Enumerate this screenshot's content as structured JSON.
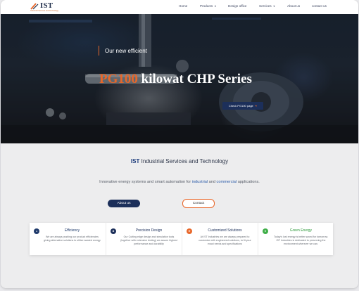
{
  "brand": {
    "logo_text": "IST",
    "tagline": "Industrial Services and Technology"
  },
  "nav": {
    "items": [
      {
        "label": "Home",
        "dropdown": false
      },
      {
        "label": "Products",
        "dropdown": true
      },
      {
        "label": "Design office",
        "dropdown": false
      },
      {
        "label": "Services",
        "dropdown": true
      },
      {
        "label": "About us",
        "dropdown": false
      },
      {
        "label": "contact us",
        "dropdown": false
      }
    ]
  },
  "hero": {
    "kicker": "Our new efficient",
    "title_accent": "PG100",
    "title_rest": " kilowat CHP Series",
    "button_label": "Check PG100 page",
    "button_icon": "arrow-right-icon"
  },
  "intro": {
    "title_brand": "IST",
    "title_rest": " Industrial Services and Technology",
    "subtitle_part1": "Innovative energy systems and smart automation for ",
    "subtitle_link1": "industrial",
    "subtitle_part2": " and ",
    "subtitle_link2": "commercial",
    "subtitle_part3": " applications.",
    "about_label": "About us",
    "contact_label": "Contact"
  },
  "features": [
    {
      "icon": "bulb-icon",
      "title": "Efficiency",
      "description": "We are always pushing our product efficiencies giving alternative solutions to utilize wasted energy",
      "color": "#1f3a6b",
      "title_color": "#1f3a6b"
    },
    {
      "icon": "gear-icon",
      "title": "Precision Design",
      "description": "Our Cutting edge design and simulation tools (together with extensive testing) we assure highest performance and durability",
      "color": "#1c2f5a",
      "title_color": "#1c2f5a"
    },
    {
      "icon": "wrench-icon",
      "title": "Customized Solutions",
      "description": "At IST Industries we are always prepared to customize with engineered solutions, to fit your exact needs and specifications",
      "color": "#e8672a",
      "title_color": "#1c2f5a"
    },
    {
      "icon": "leaf-icon",
      "title": "Green Energy",
      "description": "Today's lost energy is better saved for tomorrow. IST Industries is dedicated to preserving the environment wherever we can.",
      "color": "#3fae48",
      "title_color": "#2f9a3c"
    }
  ],
  "colors": {
    "accent": "#e8672a",
    "primary": "#1c2f5a",
    "green": "#3fae48"
  }
}
